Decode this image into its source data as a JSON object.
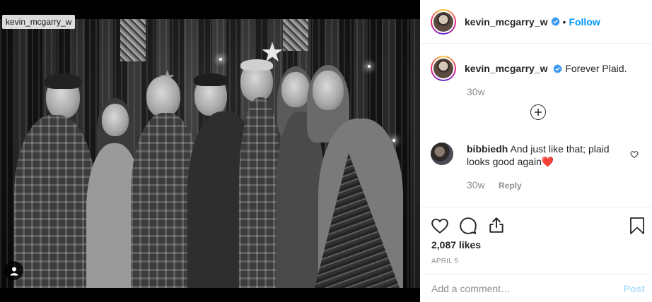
{
  "photo": {
    "user_tag": "kevin_mcgarry_w"
  },
  "header": {
    "username": "kevin_mcgarry_w",
    "separator": "•",
    "follow_label": "Follow"
  },
  "caption": {
    "username": "kevin_mcgarry_w",
    "text": "Forever Plaid.",
    "time": "30w"
  },
  "comments": [
    {
      "username": "bibbiedh",
      "text": "And just like that; plaid looks good again❤️",
      "time": "30w",
      "reply_label": "Reply"
    }
  ],
  "post": {
    "likes": "2,087 likes",
    "date": "APRIL 5"
  },
  "add_comment": {
    "placeholder": "Add a comment…",
    "post_label": "Post"
  },
  "colors": {
    "accent": "#0095f6",
    "heart": "#ed4956",
    "muted": "#8e8e8e"
  },
  "icons": [
    "user-tag-icon",
    "verified-badge-icon",
    "plus-circle-icon",
    "heart-icon",
    "comment-icon",
    "share-icon",
    "bookmark-icon"
  ]
}
